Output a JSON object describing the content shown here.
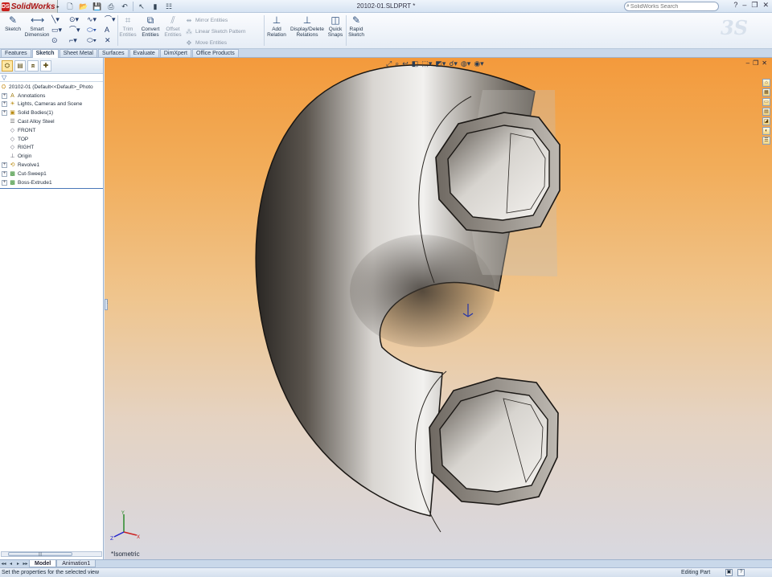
{
  "app": {
    "logo_text": "SolidWorks",
    "document_title": "20102-01.SLDPRT *",
    "search_placeholder": "SolidWorks Search"
  },
  "ribbon": {
    "sketch": "Sketch",
    "smart_dimension": "Smart Dimension",
    "trim_entities": "Trim Entities",
    "convert_entities": "Convert Entities",
    "offset_entities": "Offset Entities",
    "mirror_entities": "Mirror Entities",
    "linear_sketch_pattern": "Linear Sketch Pattern",
    "move_entities": "Move Entities",
    "add_relation": "Add Relation",
    "display_delete_relations": "Display/Delete Relations",
    "quick_snaps": "Quick Snaps",
    "rapid_sketch": "Rapid Sketch"
  },
  "command_tabs": [
    "Features",
    "Sketch",
    "Sheet Metal",
    "Surfaces",
    "Evaluate",
    "DimXpert",
    "Office Products"
  ],
  "active_command_tab": "Sketch",
  "feature_tree": {
    "root": "20102-01  (Default<<Default>_Photo",
    "items": [
      {
        "label": "Annotations",
        "icon": "annotations-icon",
        "expand": true
      },
      {
        "label": "Lights, Cameras and Scene",
        "icon": "lights-icon",
        "expand": true
      },
      {
        "label": "Solid Bodies(1)",
        "icon": "solid-bodies-icon",
        "expand": true
      },
      {
        "label": "Cast Alloy Steel",
        "icon": "material-icon",
        "expand": false
      },
      {
        "label": "FRONT",
        "icon": "plane-icon",
        "expand": false
      },
      {
        "label": "TOP",
        "icon": "plane-icon",
        "expand": false
      },
      {
        "label": "RIGHT",
        "icon": "plane-icon",
        "expand": false
      },
      {
        "label": "Origin",
        "icon": "origin-icon",
        "expand": false
      },
      {
        "label": "Revolve1",
        "icon": "revolve-icon",
        "expand": true
      },
      {
        "label": "Cut-Sweep1",
        "icon": "cut-sweep-icon",
        "expand": true
      },
      {
        "label": "Boss-Extrude1",
        "icon": "extrude-icon",
        "expand": true
      }
    ]
  },
  "viewport": {
    "view_name": "*Isometric",
    "background_top": "#f39a3c",
    "background_bottom": "#d8d8e0"
  },
  "bottom_tabs": [
    "Model",
    "Animation1"
  ],
  "active_bottom_tab": "Model",
  "status": {
    "message": "Set the properties for the selected view",
    "mode": "Editing Part"
  }
}
